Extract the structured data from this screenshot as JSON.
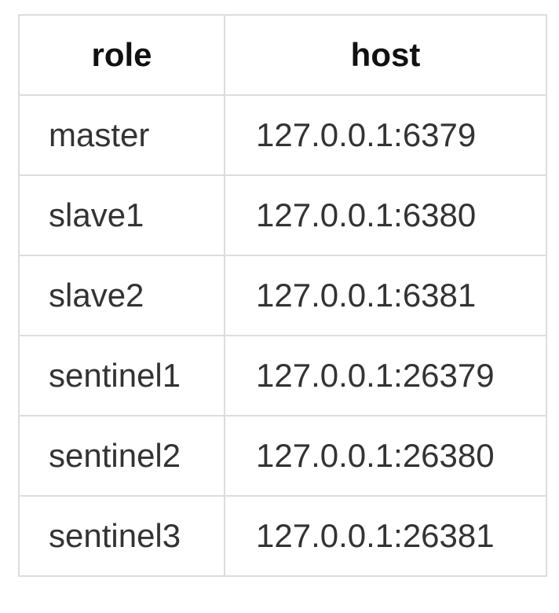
{
  "table": {
    "headers": [
      "role",
      "host"
    ],
    "rows": [
      [
        "master",
        "127.0.0.1:6379"
      ],
      [
        "slave1",
        "127.0.0.1:6380"
      ],
      [
        "slave2",
        "127.0.0.1:6381"
      ],
      [
        "sentinel1",
        "127.0.0.1:26379"
      ],
      [
        "sentinel2",
        "127.0.0.1:26380"
      ],
      [
        "sentinel3",
        "127.0.0.1:26381"
      ]
    ]
  }
}
